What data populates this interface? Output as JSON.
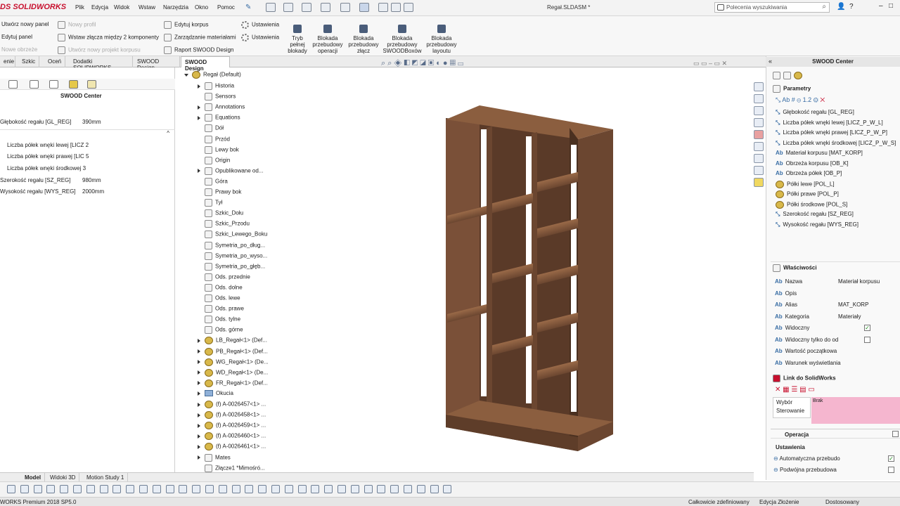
{
  "app": {
    "logo": "DS SOLIDWORKS",
    "document_title": "Regał.SLDASM *"
  },
  "menu": [
    "Plik",
    "Edycja",
    "Widok",
    "Wstaw",
    "Narzędzia",
    "Okno",
    "Pomoc"
  ],
  "search": {
    "placeholder": "Polecenia wyszukiwania"
  },
  "command": {
    "col1": [
      "Utwórz nowy panel",
      "Edytuj panel",
      "Nowe obrzeże"
    ],
    "col2": [
      "Nowy profil",
      "Wstaw złącza między 2 komponenty",
      "Utwórz nowy projekt korpusu"
    ],
    "col3": [
      "Edytuj korpus",
      "Zarządzanie materiałami",
      "Raport SWOOD Design"
    ],
    "col4": [
      "Ustawienia",
      "Ustawienia"
    ],
    "big": [
      "Tryb\npełnej\nblokady",
      "Blokada\nprzebudowy\noperacji",
      "Blokada\nprzebudowy\nzłącz",
      "Blokada\nprzebudowy\nSWOODBoxów",
      "Blokada\nprzebudowy\nlayoutu"
    ]
  },
  "tabs": [
    "enie",
    "Szkic",
    "Oceń",
    "Dodatki SOLIDWORKS",
    "SWOOD Design",
    "SWOOD Design"
  ],
  "left_panel": {
    "title": "SWOOD Center",
    "rows": [
      {
        "label": "Głębokość regału [GL_REG]",
        "value": "390mm"
      },
      {
        "label": "Liczba półek wnęki lewej [LICZ 2",
        "value": ""
      },
      {
        "label": "Liczba półek wnęki prawej [LIC 5",
        "value": ""
      },
      {
        "label": "Liczba półek wnęki środkowej 3",
        "value": ""
      },
      {
        "label": "Szerokość regału [SZ_REG]",
        "value": "980mm"
      },
      {
        "label": "Wysokość regału [WYS_REG]",
        "value": "2000mm"
      }
    ]
  },
  "tree": {
    "root": "Regał (Default)",
    "items": [
      {
        "label": "Historia",
        "icon": "history-icon",
        "arrow": true
      },
      {
        "label": "Sensors",
        "icon": "sensor-icon",
        "arrow": false
      },
      {
        "label": "Annotations",
        "icon": "annotation-icon",
        "arrow": true
      },
      {
        "label": "Equations",
        "icon": "equation-icon",
        "arrow": true
      },
      {
        "label": "Dół",
        "icon": "plane-icon",
        "arrow": false
      },
      {
        "label": "Przód",
        "icon": "plane-icon",
        "arrow": false
      },
      {
        "label": "Lewy bok",
        "icon": "plane-icon",
        "arrow": false
      },
      {
        "label": "Origin",
        "icon": "origin-icon",
        "arrow": false
      },
      {
        "label": "Opublikowane od...",
        "icon": "published-icon",
        "arrow": true
      },
      {
        "label": "Góra",
        "icon": "plane-icon",
        "arrow": false
      },
      {
        "label": "Prawy bok",
        "icon": "plane-icon",
        "arrow": false
      },
      {
        "label": "Tył",
        "icon": "plane-icon",
        "arrow": false
      },
      {
        "label": "Szkic_Dołu",
        "icon": "sketch-icon",
        "arrow": false
      },
      {
        "label": "Szkic_Przodu",
        "icon": "sketch-icon",
        "arrow": false
      },
      {
        "label": "Szkic_Lewego_Boku",
        "icon": "sketch-icon",
        "arrow": false
      },
      {
        "label": "Symetria_po_dług...",
        "icon": "plane-icon",
        "arrow": false
      },
      {
        "label": "Symetria_po_wyso...",
        "icon": "plane-icon",
        "arrow": false
      },
      {
        "label": "Symetria_po_głęb...",
        "icon": "plane-icon",
        "arrow": false
      },
      {
        "label": "Ods. przednie",
        "icon": "plane-icon",
        "arrow": false
      },
      {
        "label": "Ods. dolne",
        "icon": "plane-icon",
        "arrow": false
      },
      {
        "label": "Ods. lewe",
        "icon": "plane-icon",
        "arrow": false
      },
      {
        "label": "Ods. prawe",
        "icon": "plane-icon",
        "arrow": false
      },
      {
        "label": "Ods. tylne",
        "icon": "plane-icon",
        "arrow": false
      },
      {
        "label": "Ods. górne",
        "icon": "plane-icon",
        "arrow": false
      },
      {
        "label": "LB_Regał<1> (Def...",
        "icon": "assembly-icon",
        "arrow": true
      },
      {
        "label": "PB_Regał<1> (Def...",
        "icon": "assembly-icon",
        "arrow": true
      },
      {
        "label": "WG_Regał<1> (De...",
        "icon": "assembly-icon",
        "arrow": true
      },
      {
        "label": "WD_Regał<1> (De...",
        "icon": "assembly-icon",
        "arrow": true
      },
      {
        "label": "FR_Regał<1> (Def...",
        "icon": "assembly-icon",
        "arrow": true
      },
      {
        "label": "Okucia",
        "icon": "folder-icon",
        "arrow": true
      },
      {
        "label": "(f) A-0026457<1> ...",
        "icon": "assembly-icon",
        "arrow": true
      },
      {
        "label": "(f) A-0026458<1> ...",
        "icon": "assembly-icon",
        "arrow": true
      },
      {
        "label": "(f) A-0026459<1> ...",
        "icon": "assembly-icon",
        "arrow": true
      },
      {
        "label": "(f) A-0026460<1> ...",
        "icon": "assembly-icon",
        "arrow": true
      },
      {
        "label": "(f) A-0026461<1> ...",
        "icon": "assembly-icon",
        "arrow": true
      },
      {
        "label": "Mates",
        "icon": "mates-icon",
        "arrow": true
      },
      {
        "label": "Złącze1 *Mimośró...",
        "icon": "joint-icon",
        "arrow": false
      }
    ]
  },
  "right_panel": {
    "title": "SWOOD Center",
    "params_title": "Parametry",
    "params": [
      "Głębokość regału [GL_REG]",
      "Liczba półek wnęki lewej [LICZ_P_W_L]",
      "Liczba półek wnęki prawej [LICZ_P_W_P]",
      "Liczba półek wnęki środkowej [LICZ_P_W_S]",
      "Materiał korpusu [MAT_KORP]",
      "Obrzeża korpusu [OB_K]",
      "Obrzeża półek [OB_P]",
      "Półki lewe [POL_L]",
      "Półki prawe [POL_P]",
      "Półki środkowe [POL_S]",
      "Szerokość regału [SZ_REG]",
      "Wysokość regału [WYS_REG]"
    ],
    "props_title": "Właściwości",
    "props": [
      {
        "label": "Nazwa",
        "value": "Materiał korpusu"
      },
      {
        "label": "Opis",
        "value": ""
      },
      {
        "label": "Alias",
        "value": "MAT_KORP"
      },
      {
        "label": "Kategoria",
        "value": "Materiały"
      },
      {
        "label": "Widoczny",
        "value": "checked"
      },
      {
        "label": "Widoczny tylko do od",
        "value": "unchecked"
      },
      {
        "label": "Wartość początkowa",
        "value": ""
      },
      {
        "label": "Warunek wyświetlania",
        "value": ""
      }
    ],
    "link_title": "Link do SolidWorks",
    "link_left": [
      "Wybór",
      "Sterowanie"
    ],
    "link_value": "Brak",
    "op_title": "Operacja",
    "settings_title": "Ustawienia",
    "settings": [
      {
        "label": "Automatyczna przebudo",
        "checked": true
      },
      {
        "label": "Podwójna przebudowa",
        "checked": false
      }
    ]
  },
  "bottom_tabs": [
    "Model",
    "Widoki 3D",
    "Motion Study 1"
  ],
  "status": {
    "left": "WORKS Premium 2018 SP5.0",
    "s1": "Całkowicie zdefiniowany",
    "s2": "Edycja Złożenie",
    "s3": "Dostosowany"
  },
  "colors": {
    "wood": "#6b4630",
    "wood_light": "#8b5e3f",
    "brand": "#c8102e",
    "link_value_bg": "#f5b6cf"
  }
}
